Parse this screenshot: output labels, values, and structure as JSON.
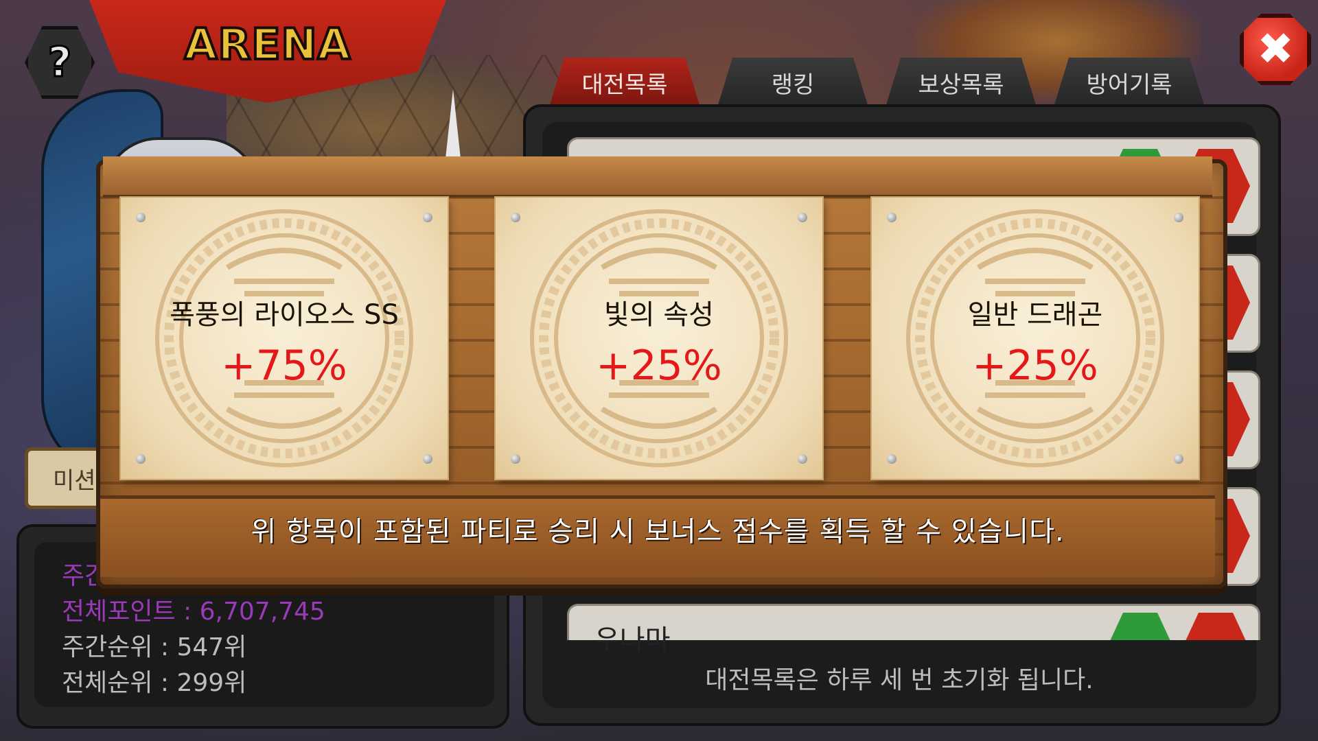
{
  "header": {
    "title": "ARENA",
    "help_label": "?",
    "close_label": "✖"
  },
  "tabs": [
    {
      "label": "대전목록",
      "active": true
    },
    {
      "label": "랭킹",
      "active": false
    },
    {
      "label": "보상목록",
      "active": false
    },
    {
      "label": "방어기록",
      "active": false
    }
  ],
  "right_panel": {
    "visible_row_name": "우나마",
    "footer": "대전목록은 하루 세 번 초기화 됩니다."
  },
  "left_panel": {
    "mission_tab_label": "미션",
    "weekly_points_label": "주간",
    "total_points": "전체포인트 : 6,707,745",
    "weekly_rank": "주간순위 : 547위",
    "total_rank": "전체순위 : 299위"
  },
  "popup": {
    "cards": [
      {
        "name": "폭풍의 라이오스 SS",
        "bonus": "+75%"
      },
      {
        "name": "빛의 속성",
        "bonus": "+25%"
      },
      {
        "name": "일반 드래곤",
        "bonus": "+25%"
      }
    ],
    "note": "위 항목이 포함된 파티로 승리 시 보너스 점수를 획득 할 수 있습니다."
  },
  "colors": {
    "accent_red": "#c8281a",
    "bonus_red": "#e41818",
    "points_purple": "#9a3ab8",
    "arena_gold": "#e8c23a",
    "wood": "#a3682e"
  }
}
